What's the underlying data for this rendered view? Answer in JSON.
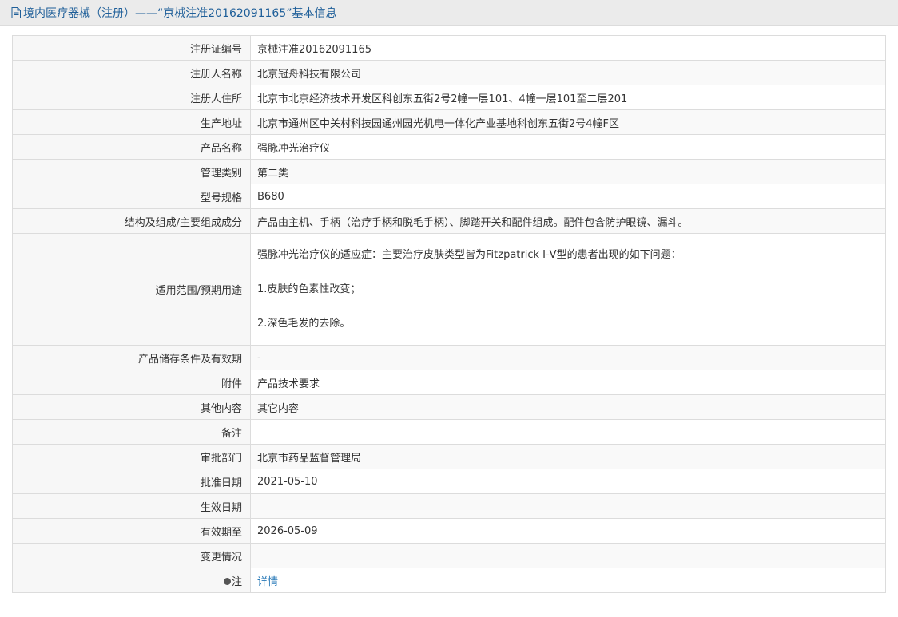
{
  "header": {
    "title": "境内医疗器械（注册）——“京械注准20162091165”基本信息"
  },
  "rows": [
    {
      "label": "注册证编号",
      "value": "京械注准20162091165"
    },
    {
      "label": "注册人名称",
      "value": "北京冠舟科技有限公司"
    },
    {
      "label": "注册人住所",
      "value": "北京市北京经济技术开发区科创东五街2号2幢一层101、4幢一层101至二层201"
    },
    {
      "label": "生产地址",
      "value": "北京市通州区中关村科技园通州园光机电一体化产业基地科创东五街2号4幢F区"
    },
    {
      "label": "产品名称",
      "value": "强脉冲光治疗仪"
    },
    {
      "label": "管理类别",
      "value": "第二类"
    },
    {
      "label": "型号规格",
      "value": "B680"
    },
    {
      "label": "结构及组成/主要组成成分",
      "value": "产品由主机、手柄（治疗手柄和脱毛手柄）、脚踏开关和配件组成。配件包含防护眼镜、漏斗。"
    }
  ],
  "scope": {
    "label": "适用范围/预期用途",
    "line1": "强脉冲光治疗仪的适应症：主要治疗皮肤类型皆为Fitzpatrick Ⅰ-Ⅴ型的患者出现的如下问题：",
    "line2": "1.皮肤的色素性改变；",
    "line3": "2.深色毛发的去除。"
  },
  "rows2": [
    {
      "label": "产品储存条件及有效期",
      "value": "-"
    },
    {
      "label": "附件",
      "value": "产品技术要求"
    },
    {
      "label": "其他内容",
      "value": "其它内容"
    },
    {
      "label": "备注",
      "value": ""
    },
    {
      "label": "审批部门",
      "value": "北京市药品监督管理局"
    },
    {
      "label": "批准日期",
      "value": "2021-05-10"
    },
    {
      "label": "生效日期",
      "value": ""
    },
    {
      "label": "有效期至",
      "value": "2026-05-09"
    },
    {
      "label": "变更情况",
      "value": ""
    }
  ],
  "note": {
    "label": "注",
    "link": "详情"
  }
}
